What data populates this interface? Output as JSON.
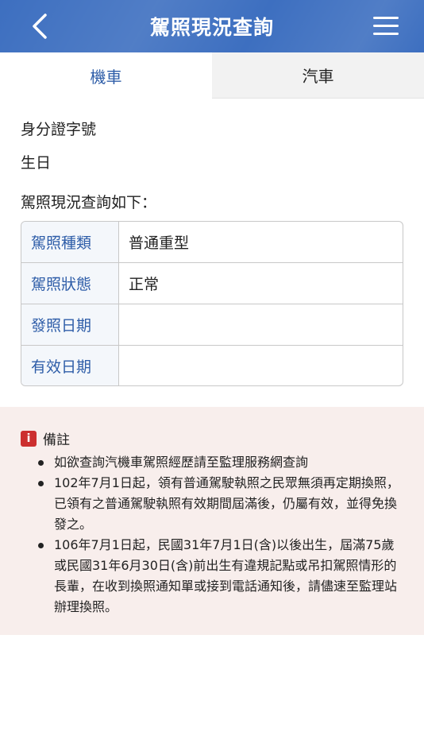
{
  "header": {
    "title": "駕照現況查詢"
  },
  "tabs": [
    {
      "label": "機車",
      "active": true
    },
    {
      "label": "汽車",
      "active": false
    }
  ],
  "fields": {
    "id_label": "身分證字號",
    "birthday_label": "生日",
    "result_label": "駕照現況查詢如下："
  },
  "table": {
    "rows": [
      {
        "label": "駕照種類",
        "value": "普通重型"
      },
      {
        "label": "駕照狀態",
        "value": "正常"
      },
      {
        "label": "發照日期",
        "value": ""
      },
      {
        "label": "有效日期",
        "value": ""
      }
    ]
  },
  "notes": {
    "icon_text": "i",
    "title": "備註",
    "items": [
      "如欲查詢汽機車駕照經歷請至監理服務網查詢",
      "102年7月1日起，領有普通駕駛執照之民眾無須再定期換照，已領有之普通駕駛執照有效期間屆滿後，仍屬有效，並得免換發之。",
      "106年7月1日起，民國31年7月1日(含)以後出生，屆滿75歲或民國31年6月30日(含)前出生有違規記點或吊扣駕照情形的長輩，在收到換照通知單或接到電話通知後，請儘速至監理站辦理換照。"
    ]
  },
  "colors": {
    "header_bg": "#3d6fc0",
    "accent": "#2e5da8",
    "notes_bg": "#f8eeec",
    "alert": "#cc2f2f"
  }
}
